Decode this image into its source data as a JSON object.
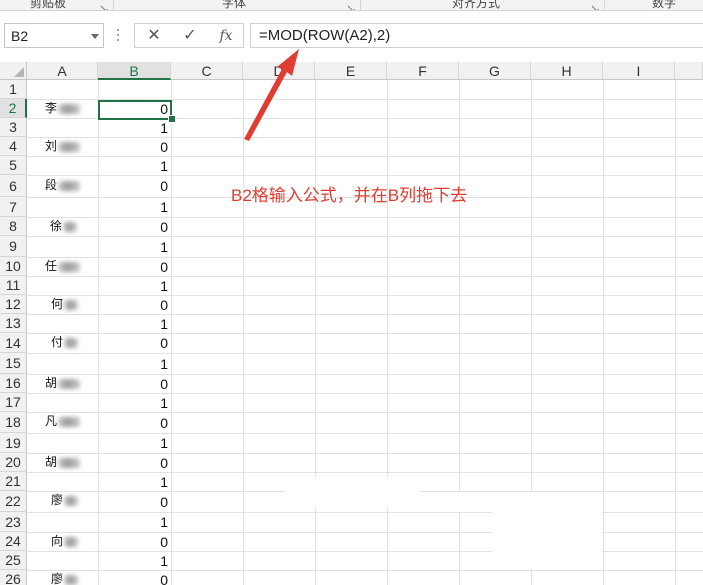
{
  "ribbon": {
    "groups": [
      "剪贴板",
      "字体",
      "对齐方式",
      "数字"
    ]
  },
  "formula_bar": {
    "name_box": "B2",
    "cancel_icon": "✕",
    "enter_icon": "✓",
    "fx_label": "fx",
    "formula": "=MOD(ROW(A2),2)"
  },
  "sheet": {
    "columns": [
      "A",
      "B",
      "C",
      "D",
      "E",
      "F",
      "G",
      "H",
      "I"
    ],
    "selected_column": "B",
    "selected_row": "2",
    "rows": [
      "1",
      "2",
      "3",
      "4",
      "5",
      "6",
      "7",
      "8",
      "9",
      "10",
      "11",
      "12",
      "13",
      "14",
      "15",
      "16",
      "17",
      "18",
      "19",
      "20",
      "21",
      "22",
      "23",
      "24",
      "25",
      "26"
    ],
    "col_b_values": [
      "0",
      "1",
      "0",
      "1",
      "0",
      "1",
      "0",
      "1",
      "0",
      "1",
      "0",
      "1",
      "0",
      "1",
      "0",
      "1",
      "0",
      "1",
      "0",
      "1",
      "0",
      "1",
      "0",
      "1",
      "0"
    ],
    "names_visible_chars": [
      "李",
      "刘",
      "段",
      "徐",
      "任",
      "何",
      "付",
      "胡",
      "凡",
      "胡",
      "廖",
      "向",
      "廖"
    ]
  },
  "annotation": {
    "text": "B2格输入公式，并在B列拖下去",
    "color": "#e03c31"
  },
  "colors": {
    "accent": "#217346",
    "arrow": "#e03c31"
  }
}
